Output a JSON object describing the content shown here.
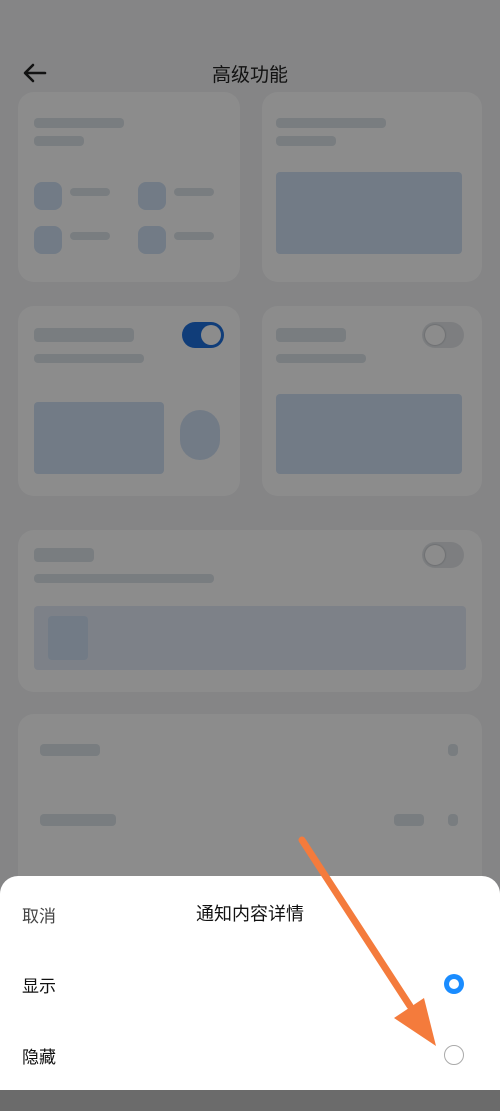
{
  "header": {
    "title": "高级功能",
    "back_icon": "back-arrow-icon"
  },
  "sheet": {
    "cancel_label": "取消",
    "title": "通知内容详情",
    "options": [
      {
        "label": "显示",
        "selected": true
      },
      {
        "label": "隐藏",
        "selected": false
      }
    ]
  },
  "colors": {
    "accent": "#1a8cff",
    "annotation_arrow": "#f47b3c"
  }
}
